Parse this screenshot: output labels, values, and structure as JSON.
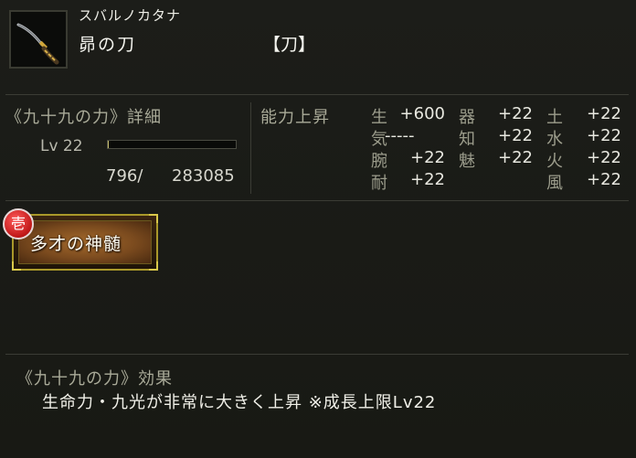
{
  "item": {
    "kana_name": "スバルノカタナ",
    "name": "昴の刀",
    "type": "【刀】",
    "icon": "katana-icon"
  },
  "growth": {
    "title": "《九十九の力》詳細",
    "level_label": "Lv 22",
    "exp_current": "796/",
    "exp_total": "283085",
    "exp_progress": 0.003
  },
  "abilities": {
    "title": "能力上昇",
    "stats": [
      {
        "name": "生",
        "value": "+600"
      },
      {
        "name": "気",
        "value": "-----"
      },
      {
        "name": "腕",
        "value": "+22"
      },
      {
        "name": "耐",
        "value": "+22"
      },
      {
        "name": "器",
        "value": "+22"
      },
      {
        "name": "知",
        "value": "+22"
      },
      {
        "name": "魅",
        "value": "+22"
      },
      {
        "name": "土",
        "value": "+22"
      },
      {
        "name": "水",
        "value": "+22"
      },
      {
        "name": "火",
        "value": "+22"
      },
      {
        "name": "風",
        "value": "+22"
      }
    ]
  },
  "skill": {
    "badge": "壱",
    "label": "多才の神髄"
  },
  "effect": {
    "title": "《九十九の力》効果",
    "text": "生命力・九光が非常に大きく上昇 ※成長上限Lv22"
  },
  "colors": {
    "accent_gold": "#d9c84a",
    "badge_red": "#c01818"
  }
}
